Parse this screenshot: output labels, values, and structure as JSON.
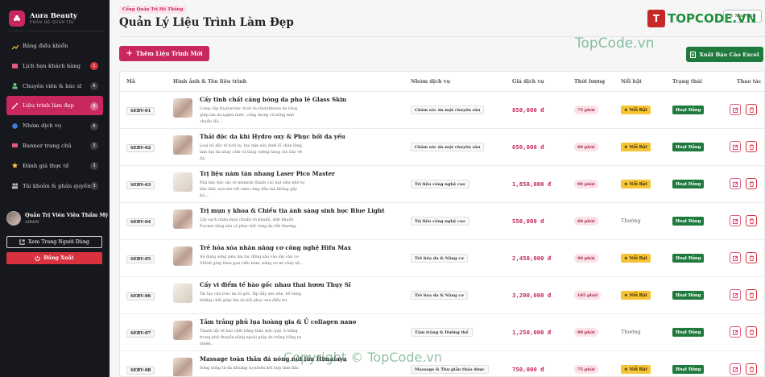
{
  "brand": {
    "title": "Aura Beauty",
    "subtitle": "PHẦN HỆ QUẢN TRỊ",
    "color": "#c8285e"
  },
  "sidebar": {
    "items": [
      {
        "label": "Bảng điều khiển",
        "icon": "chart-line-icon",
        "badge": ""
      },
      {
        "label": "Lịch hẹn khách hàng",
        "icon": "calendar-icon",
        "badge": "1"
      },
      {
        "label": "Chuyên viên & bác sĩ",
        "icon": "user-doctor-icon",
        "badge": "6"
      },
      {
        "label": "Liệu trình làm đẹp",
        "icon": "magic-wand-icon",
        "badge": "8"
      },
      {
        "label": "Nhóm dịch vụ",
        "icon": "layers-icon",
        "badge": "6"
      },
      {
        "label": "Banner trang chủ",
        "icon": "image-icon",
        "badge": "3"
      },
      {
        "label": "Đánh giá thực tế",
        "icon": "star-icon",
        "badge": "3"
      },
      {
        "label": "Tài khoản & phân quyền",
        "icon": "users-icon",
        "badge": "3"
      }
    ],
    "active_index": 3
  },
  "user": {
    "name": "Quản Trị Viên Viện Thẩm Mỹ",
    "role": "ADMIN"
  },
  "view_site_label": "Xem Trang Người Dùng",
  "logout_label": "Đăng Xuất",
  "header": {
    "breadcrumb": "Cổng Quản Trị Hệ Thống",
    "title": "Quản Lý Liệu Trình Làm Đẹp",
    "view_web_label": "Xem Web"
  },
  "toolbar": {
    "add_label": "Thêm Liệu Trình Mới",
    "export_label": "Xuất Báo Cáo Excel"
  },
  "table": {
    "columns": [
      "Mã",
      "Hình ảnh & Tên liệu trình",
      "Nhóm dịch vụ",
      "Giá dịch vụ",
      "Thời lượng",
      "Nổi bật",
      "Trạng thái",
      "Thao tác"
    ],
    "rows": [
      {
        "code": "SERV-01",
        "name": "Cấy tinh chất căng bóng da pha lê Glass Skin",
        "desc": "Cung cấp Hyaluronic Acid và Glutathione đa tầng giúp làn da ngậm nước, căng mọng và bóng mịn chuẩn Hà...",
        "category": "Chăm sóc da mặt chuyên sâu",
        "price": "850,000 đ",
        "duration": "75 phút",
        "featured": true,
        "featured_label": "Nổi Bật",
        "status": "Hoạt Động"
      },
      {
        "code": "SERV-02",
        "name": "Thải độc da khí Hydro oxy & Phục hồi da yếu",
        "desc": "Loại bỏ độc tố tích tụ, bụi mịn sâu dưới lỗ chân lông, làm dịu da nhạy cảm và tăng cường hàng rào bảo vệ da.",
        "category": "Chăm sóc da mặt chuyên sâu",
        "price": "650,000 đ",
        "duration": "60 phút",
        "featured": true,
        "featured_label": "Nổi Bật",
        "status": "Hoạt Động"
      },
      {
        "code": "SERV-03",
        "name": "Trị liệu nám tàn nhang Laser Pico Master",
        "desc": "Phá hủy hắc sắc tố melanin thành các hạt siêu nhỏ tự đào thải, xóa mờ vết nám công đầu mà không gây bỏ...",
        "category": "Trị liệu công nghệ cao",
        "price": "1,850,000 đ",
        "duration": "90 phút",
        "featured": true,
        "featured_label": "Nổi Bật",
        "status": "Hoạt Động"
      },
      {
        "code": "SERV-04",
        "name": "Trị mụn y khoa & Chiếu tia ánh sáng sinh học Blue Light",
        "desc": "Lấy sạch nhân mụn chuẩn vô khuẩn, diệt khuẩn P.acnes tầng sâu và phục hồi vùng da tổn thương.",
        "category": "Trị liệu công nghệ cao",
        "price": "550,000 đ",
        "duration": "60 phút",
        "featured": false,
        "featured_label": "Thường",
        "status": "Hoạt Động"
      },
      {
        "code": "SERV-05",
        "name": "Trẻ hóa xóa nhăn nâng cơ công nghệ Hifu Max",
        "desc": "Sử dụng sóng siêu âm tác động sâu vào lớp cân cơ SMAS giúp thon gọn viền hàm, nâng cơ mí chảy xệ...",
        "category": "Trẻ hóa da & Nâng cơ",
        "price": "2,450,000 đ",
        "duration": "90 phút",
        "featured": true,
        "featured_label": "Nổi Bật",
        "status": "Hoạt Động"
      },
      {
        "code": "SERV-06",
        "name": "Cấy vi điểm tế bào gốc nhau thai hươu Thụy Sĩ",
        "desc": "Tái tạo cấu trúc da từ gốc, lấp đầy sẹo nhẹ, bổ sung dưỡng chất giúp làn da hồi phục sau điều trị.",
        "category": "Trẻ hóa da & Nâng cơ",
        "price": "3,200,000 đ",
        "duration": "105 phút",
        "featured": true,
        "featured_label": "Nổi Bật",
        "status": "Hoạt Động"
      },
      {
        "code": "SERV-07",
        "name": "Tắm trắng phủ lụa hoàng gia & Ủ collagen nano",
        "desc": "Thanh tẩy tế bào chết bằng thảo mộc quý, ủ trắng trong phủ thuyền nâng ngoài giúp da trắng hồng tự nhiên.",
        "category": "Tắm trắng & Dưỡng thể",
        "price": "1,250,000 đ",
        "duration": "90 phút",
        "featured": false,
        "featured_label": "Thường",
        "status": "Hoạt Động"
      },
      {
        "code": "SERV-08",
        "name": "Massage toàn thân đá nóng núi lửa Himalaya",
        "desc": "Sóng nóng từ đá khoáng tự nhiên kết hợp tinh dầu",
        "category": "Massage & Thư giãn thảo dược",
        "price": "750,000 đ",
        "duration": "75 phút",
        "featured": true,
        "featured_label": "Nổi Bật",
        "status": "Hoạt Động"
      }
    ]
  },
  "watermark": {
    "logo_mark": "T",
    "logo_text": "TOPCODE.VN",
    "site": "TopCode.vn",
    "copyright": "Copyright © TopCode.vn"
  },
  "colors": {
    "accent": "#c8285e",
    "success": "#1f7a3e",
    "featured": "#f6c436",
    "sidebar_bg": "#17181d"
  }
}
